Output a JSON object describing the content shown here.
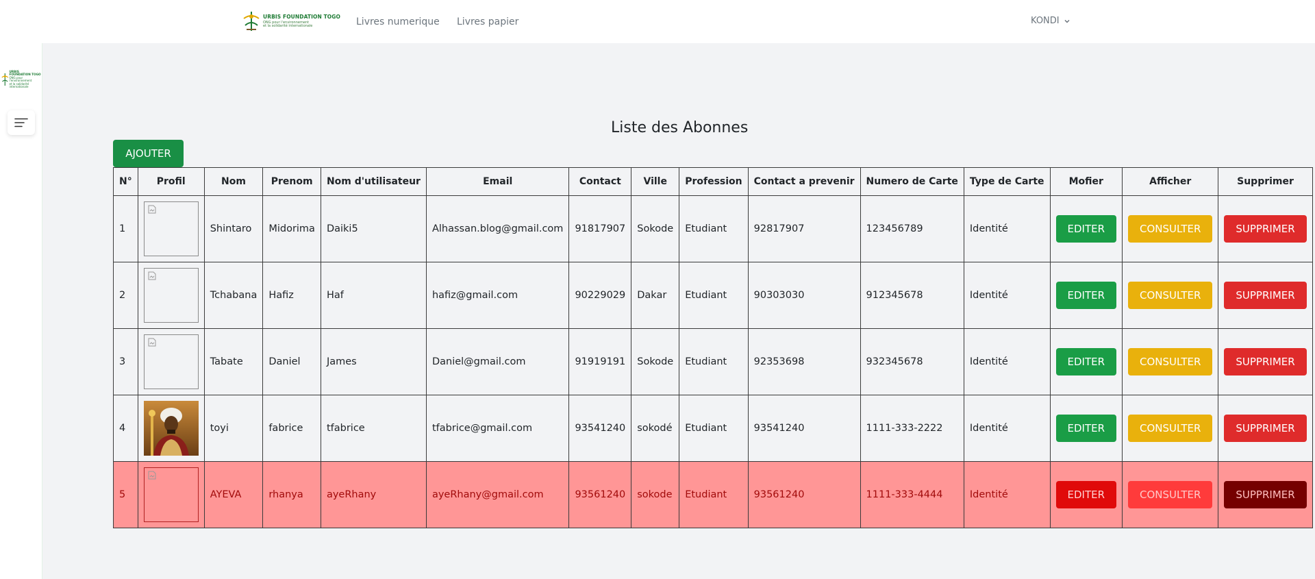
{
  "brand": {
    "title": "URBIS FOUNDATION TOGO",
    "subtitle_line1": "ONG pour l'environnement",
    "subtitle_line2": "et la solidarité internationale"
  },
  "nav": {
    "links": [
      "Livres numerique",
      "Livres papier"
    ],
    "user": "KONDI"
  },
  "page": {
    "title": "Liste des Abonnes",
    "add_label": "AJOUTER"
  },
  "table": {
    "headers": [
      "N°",
      "Profil",
      "Nom",
      "Prenom",
      "Nom d'utilisateur",
      "Email",
      "Contact",
      "Ville",
      "Profession",
      "Contact a prevenir",
      "Numero de Carte",
      "Type de Carte",
      "Mofier",
      "Afficher",
      "Supprimer"
    ],
    "actions": {
      "edit": "EDITER",
      "view": "CONSULTER",
      "delete": "SUPPRIMER"
    },
    "rows": [
      {
        "n": "1",
        "photo": "broken",
        "nom": "Shintaro",
        "prenom": "Midorima",
        "username": "Daiki5",
        "email": "Alhassan.blog@gmail.com",
        "contact": "91817907",
        "ville": "Sokode",
        "profession": "Etudiant",
        "contact_prevenir": "92817907",
        "numero_carte": "123456789",
        "type_carte": "Identité"
      },
      {
        "n": "2",
        "photo": "broken",
        "nom": "Tchabana",
        "prenom": "Hafiz",
        "username": "Haf",
        "email": "hafiz@gmail.com",
        "contact": "90229029",
        "ville": "Dakar",
        "profession": "Etudiant",
        "contact_prevenir": "90303030",
        "numero_carte": "912345678",
        "type_carte": "Identité"
      },
      {
        "n": "3",
        "photo": "broken",
        "nom": "Tabate",
        "prenom": "Daniel",
        "username": "James",
        "email": "Daniel@gmail.com",
        "contact": "91919191",
        "ville": "Sokode",
        "profession": "Etudiant",
        "contact_prevenir": "92353698",
        "numero_carte": "932345678",
        "type_carte": "Identité"
      },
      {
        "n": "4",
        "photo": "portrait",
        "nom": "toyi",
        "prenom": "fabrice",
        "username": "tfabrice",
        "email": "tfabrice@gmail.com",
        "contact": "93541240",
        "ville": "sokodé",
        "profession": "Etudiant",
        "contact_prevenir": "93541240",
        "numero_carte": "1111-333-2222",
        "type_carte": "Identité"
      },
      {
        "n": "5",
        "photo": "broken",
        "nom": "AYEVA",
        "prenom": "rhanya",
        "username": "ayeRhany",
        "email": "ayeRhany@gmail.com",
        "contact": "93561240",
        "ville": "sokode",
        "profession": "Etudiant",
        "contact_prevenir": "93561240",
        "numero_carte": "1111-333-4444",
        "type_carte": "Identité",
        "highlighted": true
      }
    ]
  },
  "colors": {
    "primary_green": "#198f45",
    "warning_yellow": "#e9b10c",
    "danger_red": "#df2b2b",
    "highlight_row": "#ff9696"
  }
}
